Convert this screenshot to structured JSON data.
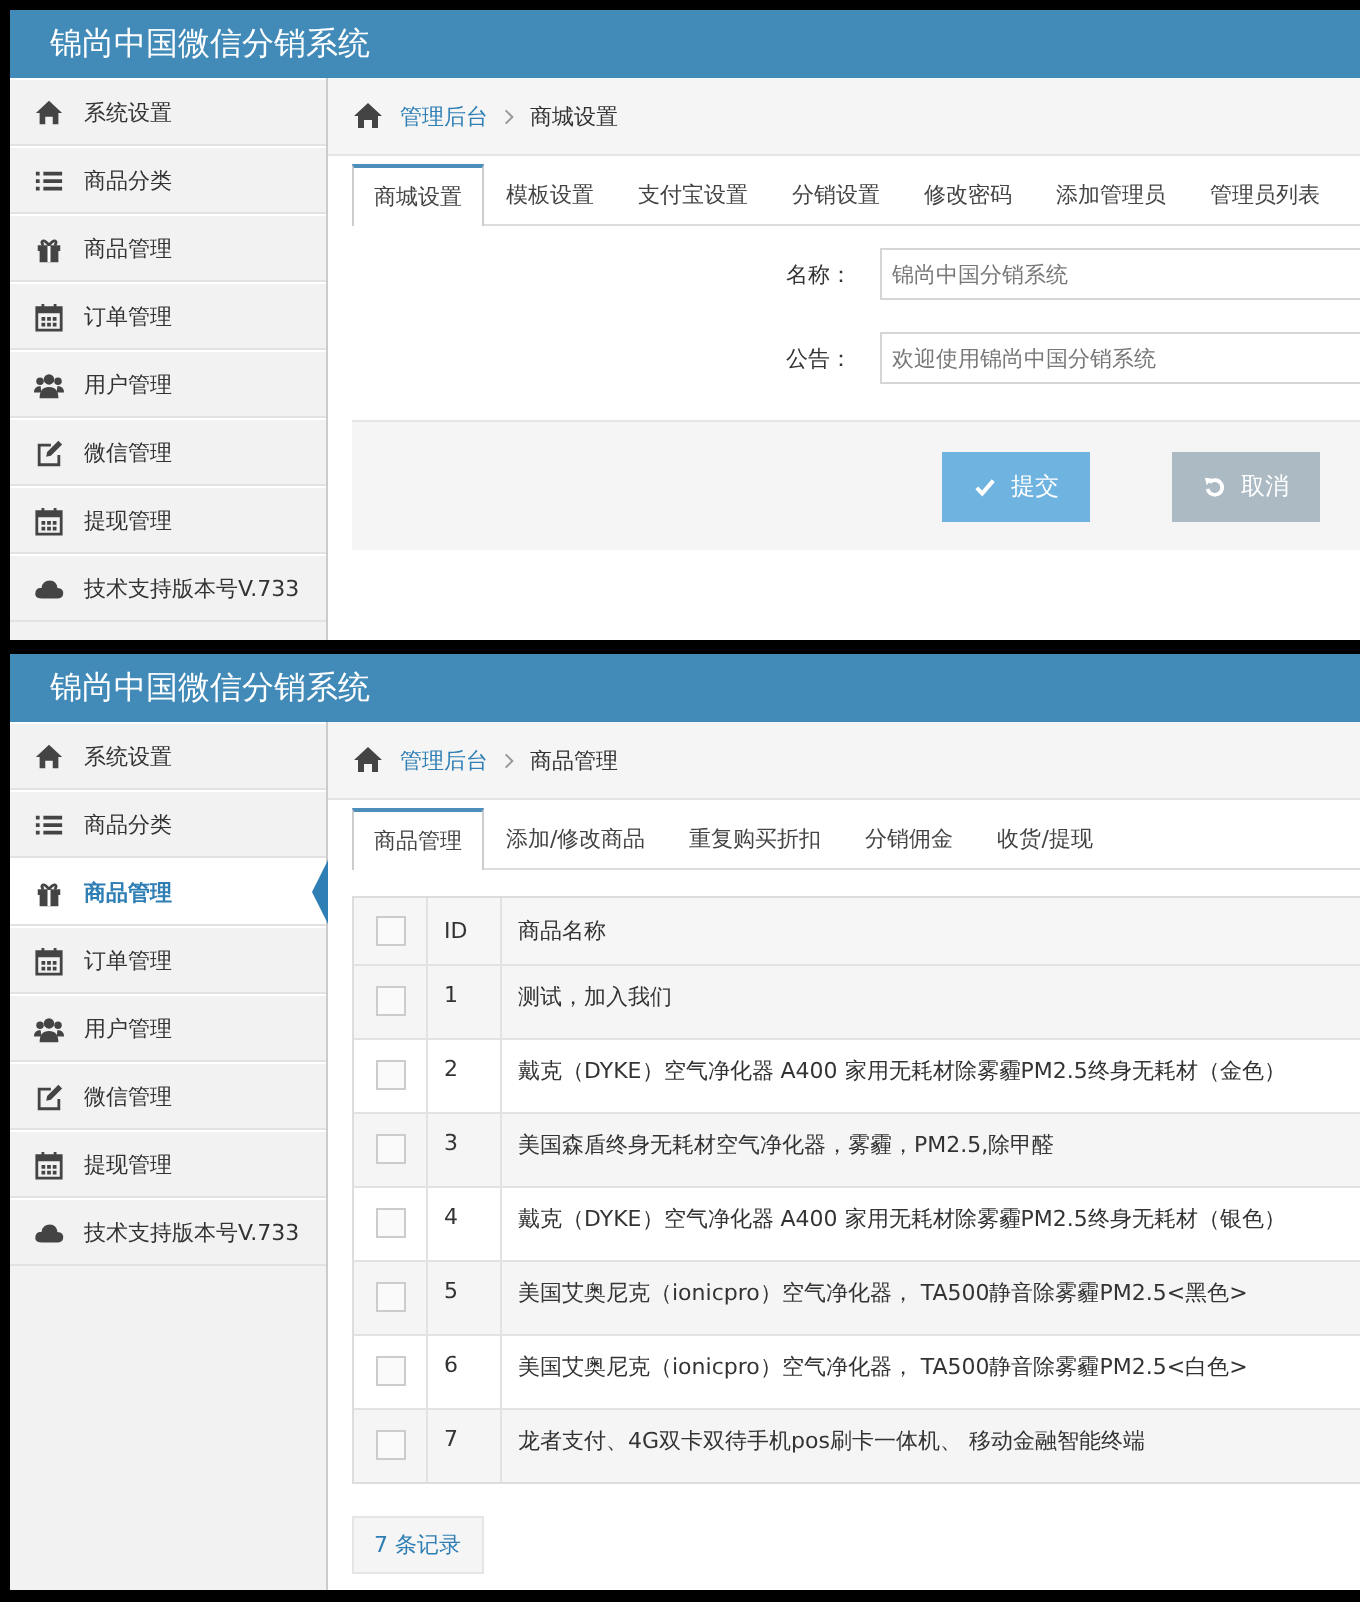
{
  "panels": [
    {
      "kind": "form",
      "header": {
        "title": "锦尚中国微信分销系统"
      },
      "sidebar": {
        "items": [
          {
            "label": "系统设置",
            "selected": false
          },
          {
            "label": "商品分类",
            "selected": false
          },
          {
            "label": "商品管理",
            "selected": false
          },
          {
            "label": "订单管理",
            "selected": false
          },
          {
            "label": "用户管理",
            "selected": false
          },
          {
            "label": "微信管理",
            "selected": false
          },
          {
            "label": "提现管理",
            "selected": false
          },
          {
            "label": "技术支持版本号V.733",
            "selected": false
          }
        ]
      },
      "breadcrumb": {
        "home": "管理后台",
        "current": "商城设置"
      },
      "tabs": [
        {
          "label": "商城设置",
          "selected": true
        },
        {
          "label": "模板设置",
          "selected": false
        },
        {
          "label": "支付宝设置",
          "selected": false
        },
        {
          "label": "分销设置",
          "selected": false
        },
        {
          "label": "修改密码",
          "selected": false
        },
        {
          "label": "添加管理员",
          "selected": false
        },
        {
          "label": "管理员列表",
          "selected": false
        }
      ],
      "form": {
        "fields": [
          {
            "label": "名称：",
            "value": "锦尚中国分销系统"
          },
          {
            "label": "公告：",
            "value": "欢迎使用锦尚中国分销系统"
          }
        ],
        "buttons": [
          {
            "label": "提交",
            "kind": "submit"
          },
          {
            "label": "取消",
            "kind": "cancel"
          }
        ]
      }
    },
    {
      "kind": "table",
      "header": {
        "title": "锦尚中国微信分销系统"
      },
      "sidebar": {
        "items": [
          {
            "label": "系统设置",
            "selected": false
          },
          {
            "label": "商品分类",
            "selected": false
          },
          {
            "label": "商品管理",
            "selected": true
          },
          {
            "label": "订单管理",
            "selected": false
          },
          {
            "label": "用户管理",
            "selected": false
          },
          {
            "label": "微信管理",
            "selected": false
          },
          {
            "label": "提现管理",
            "selected": false
          },
          {
            "label": "技术支持版本号V.733",
            "selected": false
          }
        ]
      },
      "breadcrumb": {
        "home": "管理后台",
        "current": "商品管理"
      },
      "tabs": [
        {
          "label": "商品管理",
          "selected": true
        },
        {
          "label": "添加/修改商品",
          "selected": false
        },
        {
          "label": "重复购买折扣",
          "selected": false
        },
        {
          "label": "分销佣金",
          "selected": false
        },
        {
          "label": "收货/提现",
          "selected": false
        }
      ],
      "table": {
        "header_checked": false,
        "columns": [
          "ID",
          "商品名称"
        ],
        "rows": [
          {
            "checked": false,
            "id": "1",
            "name": "测试，加入我们"
          },
          {
            "checked": false,
            "id": "2",
            "name": "戴克（DYKE）空气净化器 A400 家用无耗材除雾霾PM2.5终身无耗材（金色）"
          },
          {
            "checked": false,
            "id": "3",
            "name": "美国森盾终身无耗材空气净化器，雾霾，PM2.5,除甲醛"
          },
          {
            "checked": false,
            "id": "4",
            "name": "戴克（DYKE）空气净化器 A400 家用无耗材除雾霾PM2.5终身无耗材（银色）"
          },
          {
            "checked": false,
            "id": "5",
            "name": "美国艾奥尼克（ionicpro）空气净化器， TA500静音除雾霾PM2.5<黑色>"
          },
          {
            "checked": false,
            "id": "6",
            "name": "美国艾奥尼克（ionicpro）空气净化器， TA500静音除雾霾PM2.5<白色>"
          },
          {
            "checked": false,
            "id": "7",
            "name": "龙者支付、4G双卡双待手机pos刷卡一体机、 移动金融智能终端"
          }
        ]
      },
      "footer": "7 条记录"
    }
  ]
}
